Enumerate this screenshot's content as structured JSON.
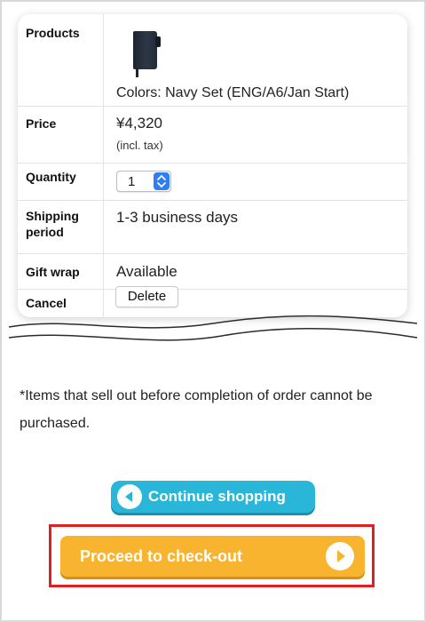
{
  "cart_item": {
    "products_label": "Products",
    "product_name": "Colors: Navy Set (ENG/A6/Jan Start)",
    "price_label": "Price",
    "price": "¥4,320",
    "price_note": "(incl. tax)",
    "quantity_label": "Quantity",
    "quantity_value": "1",
    "shipping_label": "Shipping period",
    "shipping_value": "1-3 business days",
    "gift_label": "Gift wrap",
    "gift_value": "Available",
    "cancel_label": "Cancel",
    "delete_label": "Delete"
  },
  "note": "*Items that sell out before completion of order cannot be purchased.",
  "buttons": {
    "continue_label": "Continue shopping",
    "checkout_label": "Proceed to check-out"
  },
  "colors": {
    "continue_bg": "#29b6d8",
    "checkout_bg": "#f8b42f",
    "highlight": "#e02020",
    "stepper": "#2f7ef5"
  },
  "icons": {
    "product": "notebook-thumbnail",
    "continue": "left-arrow-circle-icon",
    "checkout": "right-arrow-circle-icon",
    "stepper": "up-down-chevron-icon"
  }
}
